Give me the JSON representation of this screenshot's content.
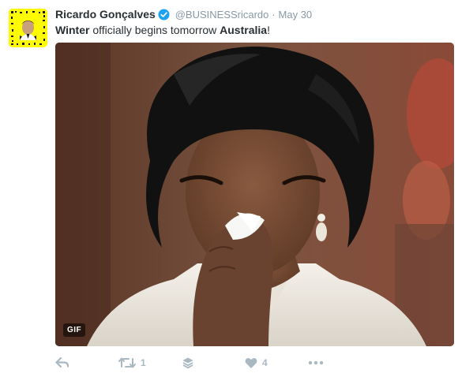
{
  "tweet": {
    "author_name": "Ricardo Gonçalves",
    "handle": "@BUSINESSricardo",
    "separator": "·",
    "date": "May 30",
    "text_parts": {
      "bold1": "Winter",
      "mid": " officially begins tomorrow ",
      "bold2": "Australia",
      "end": "!"
    },
    "media": {
      "badge": "GIF"
    },
    "actions": {
      "retweet_count": "1",
      "like_count": "4"
    }
  },
  "icons": {
    "verified": "verified-badge-icon",
    "reply": "reply-icon",
    "retweet": "retweet-icon",
    "layers": "layers-icon",
    "like": "heart-icon",
    "more": "more-dots-icon"
  },
  "colors": {
    "accent_blue": "#1da1f2",
    "muted": "#8899a6",
    "action_grey": "#aab8c2",
    "snapchat_yellow": "#fffc00"
  }
}
